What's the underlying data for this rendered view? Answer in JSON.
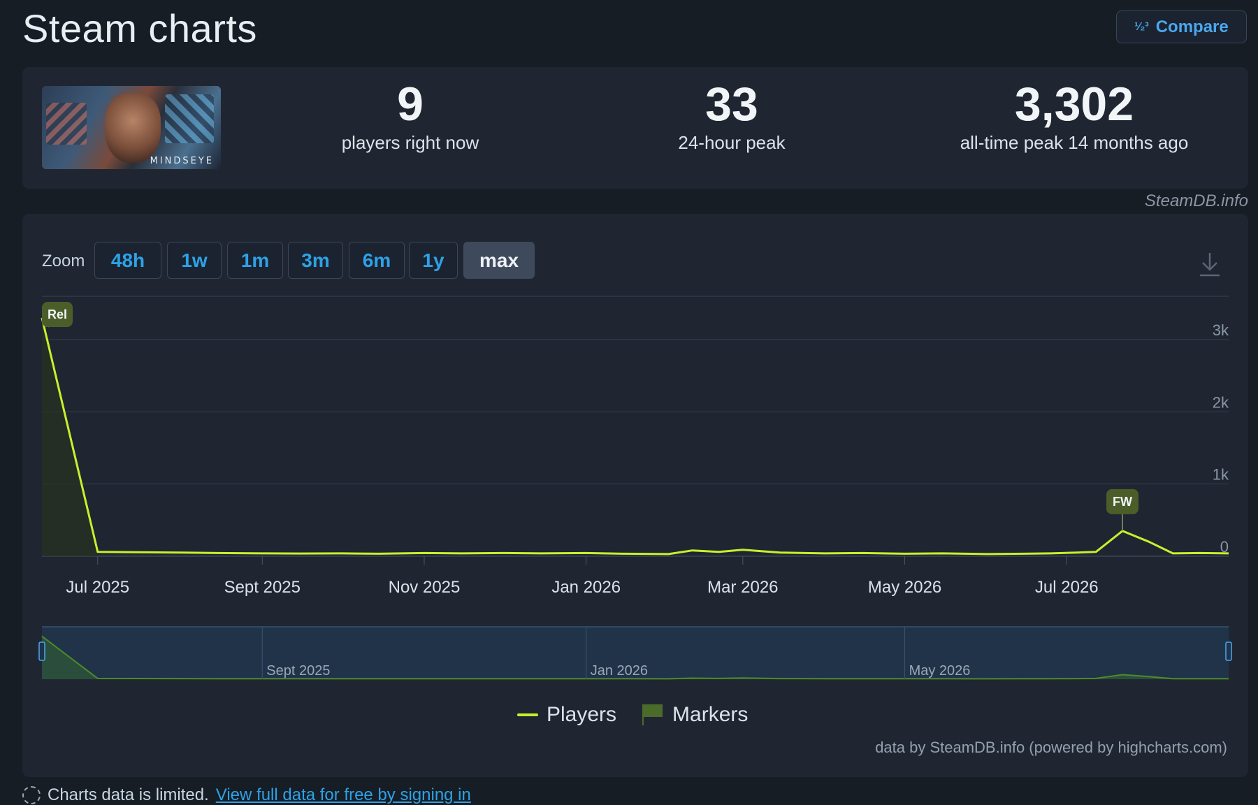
{
  "header": {
    "title": "Steam charts",
    "compare_label": "Compare",
    "compare_icon": "sort-numeric-icon"
  },
  "game": {
    "logo_text": "MINDSEYE"
  },
  "stats": {
    "now_value": "9",
    "now_label": "players right now",
    "peak24_value": "33",
    "peak24_label": "24-hour peak",
    "alltime_value": "3,302",
    "alltime_label": "all-time peak 14 months ago"
  },
  "watermark": "SteamDB.info",
  "zoom": {
    "label": "Zoom",
    "options": [
      "48h",
      "1w",
      "1m",
      "3m",
      "6m",
      "1y",
      "max"
    ],
    "active": "max"
  },
  "chart_data": {
    "type": "line",
    "series": [
      {
        "name": "Players",
        "color": "#c8f02c",
        "points": [
          [
            "2025-06-10",
            3302
          ],
          [
            "2025-07-01",
            60
          ],
          [
            "2025-07-15",
            55
          ],
          [
            "2025-08-01",
            50
          ],
          [
            "2025-08-15",
            45
          ],
          [
            "2025-09-01",
            40
          ],
          [
            "2025-09-15",
            38
          ],
          [
            "2025-10-01",
            40
          ],
          [
            "2025-10-15",
            35
          ],
          [
            "2025-11-01",
            45
          ],
          [
            "2025-11-15",
            40
          ],
          [
            "2025-12-01",
            45
          ],
          [
            "2025-12-15",
            40
          ],
          [
            "2026-01-01",
            45
          ],
          [
            "2026-01-15",
            35
          ],
          [
            "2026-02-01",
            30
          ],
          [
            "2026-02-10",
            80
          ],
          [
            "2026-02-20",
            60
          ],
          [
            "2026-03-01",
            90
          ],
          [
            "2026-03-15",
            50
          ],
          [
            "2026-04-01",
            40
          ],
          [
            "2026-04-15",
            45
          ],
          [
            "2026-05-01",
            35
          ],
          [
            "2026-05-15",
            40
          ],
          [
            "2026-06-01",
            30
          ],
          [
            "2026-06-15",
            35
          ],
          [
            "2026-06-25",
            40
          ],
          [
            "2026-07-05",
            50
          ],
          [
            "2026-07-12",
            60
          ],
          [
            "2026-07-22",
            350
          ],
          [
            "2026-08-01",
            200
          ],
          [
            "2026-08-10",
            40
          ],
          [
            "2026-08-20",
            45
          ],
          [
            "2026-08-31",
            40
          ]
        ]
      }
    ],
    "markers": [
      {
        "label": "Rel",
        "date": "2025-06-10"
      },
      {
        "label": "FW",
        "date": "2026-07-22"
      }
    ],
    "x_ticks": [
      "Jul 2025",
      "Sept 2025",
      "Nov 2025",
      "Jan 2026",
      "Mar 2026",
      "May 2026",
      "Jul 2026"
    ],
    "y_ticks": [
      "0",
      "1k",
      "2k",
      "3k"
    ],
    "ylim": [
      0,
      3600
    ],
    "xlim": [
      "2025-06-10",
      "2026-08-31"
    ],
    "navigator_labels": [
      "Sept 2025",
      "Jan 2026",
      "May 2026"
    ],
    "grid": true,
    "legend": [
      "Players",
      "Markers"
    ],
    "legend_position": "bottom-center"
  },
  "credits": "data by SteamDB.info (powered by highcharts.com)",
  "footer": {
    "text": "Charts data is limited.",
    "link": "View full data for free by signing in"
  }
}
